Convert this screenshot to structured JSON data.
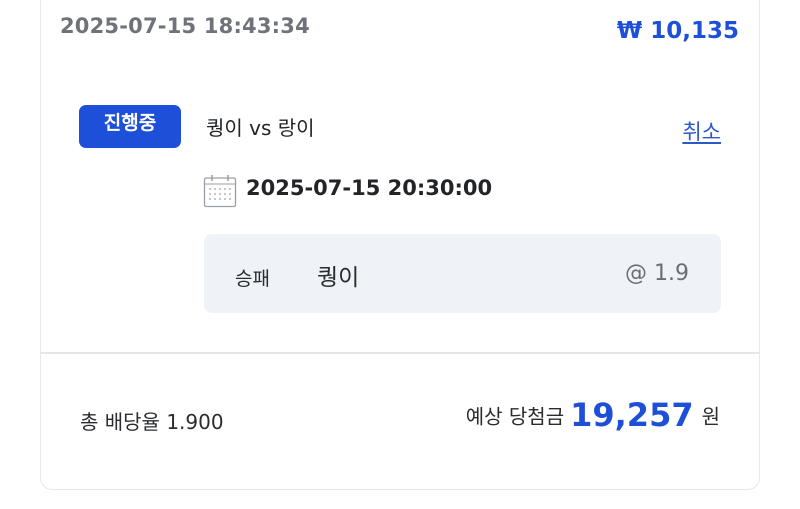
{
  "bet": {
    "placed_at": "2025-07-15 18:43:34",
    "stake": "₩ 10,135",
    "status_badge": "진행중",
    "match_title": "퀑이 vs 랑이",
    "cancel_label": "취소",
    "match_time": "2025-07-15 20:30:00",
    "selection": {
      "market": "승패",
      "pick": "퀑이",
      "odds": "@ 1.9"
    }
  },
  "summary": {
    "total_odds": "총 배당율 1.900",
    "payout_label": "예상 당첨금",
    "payout_value": "19,257",
    "payout_unit": "원"
  },
  "icons": {
    "calendar": "calendar-icon"
  },
  "colors": {
    "accent": "#1d4fd8",
    "muted_text": "#6f7379",
    "selection_bg": "#eff2f6"
  }
}
